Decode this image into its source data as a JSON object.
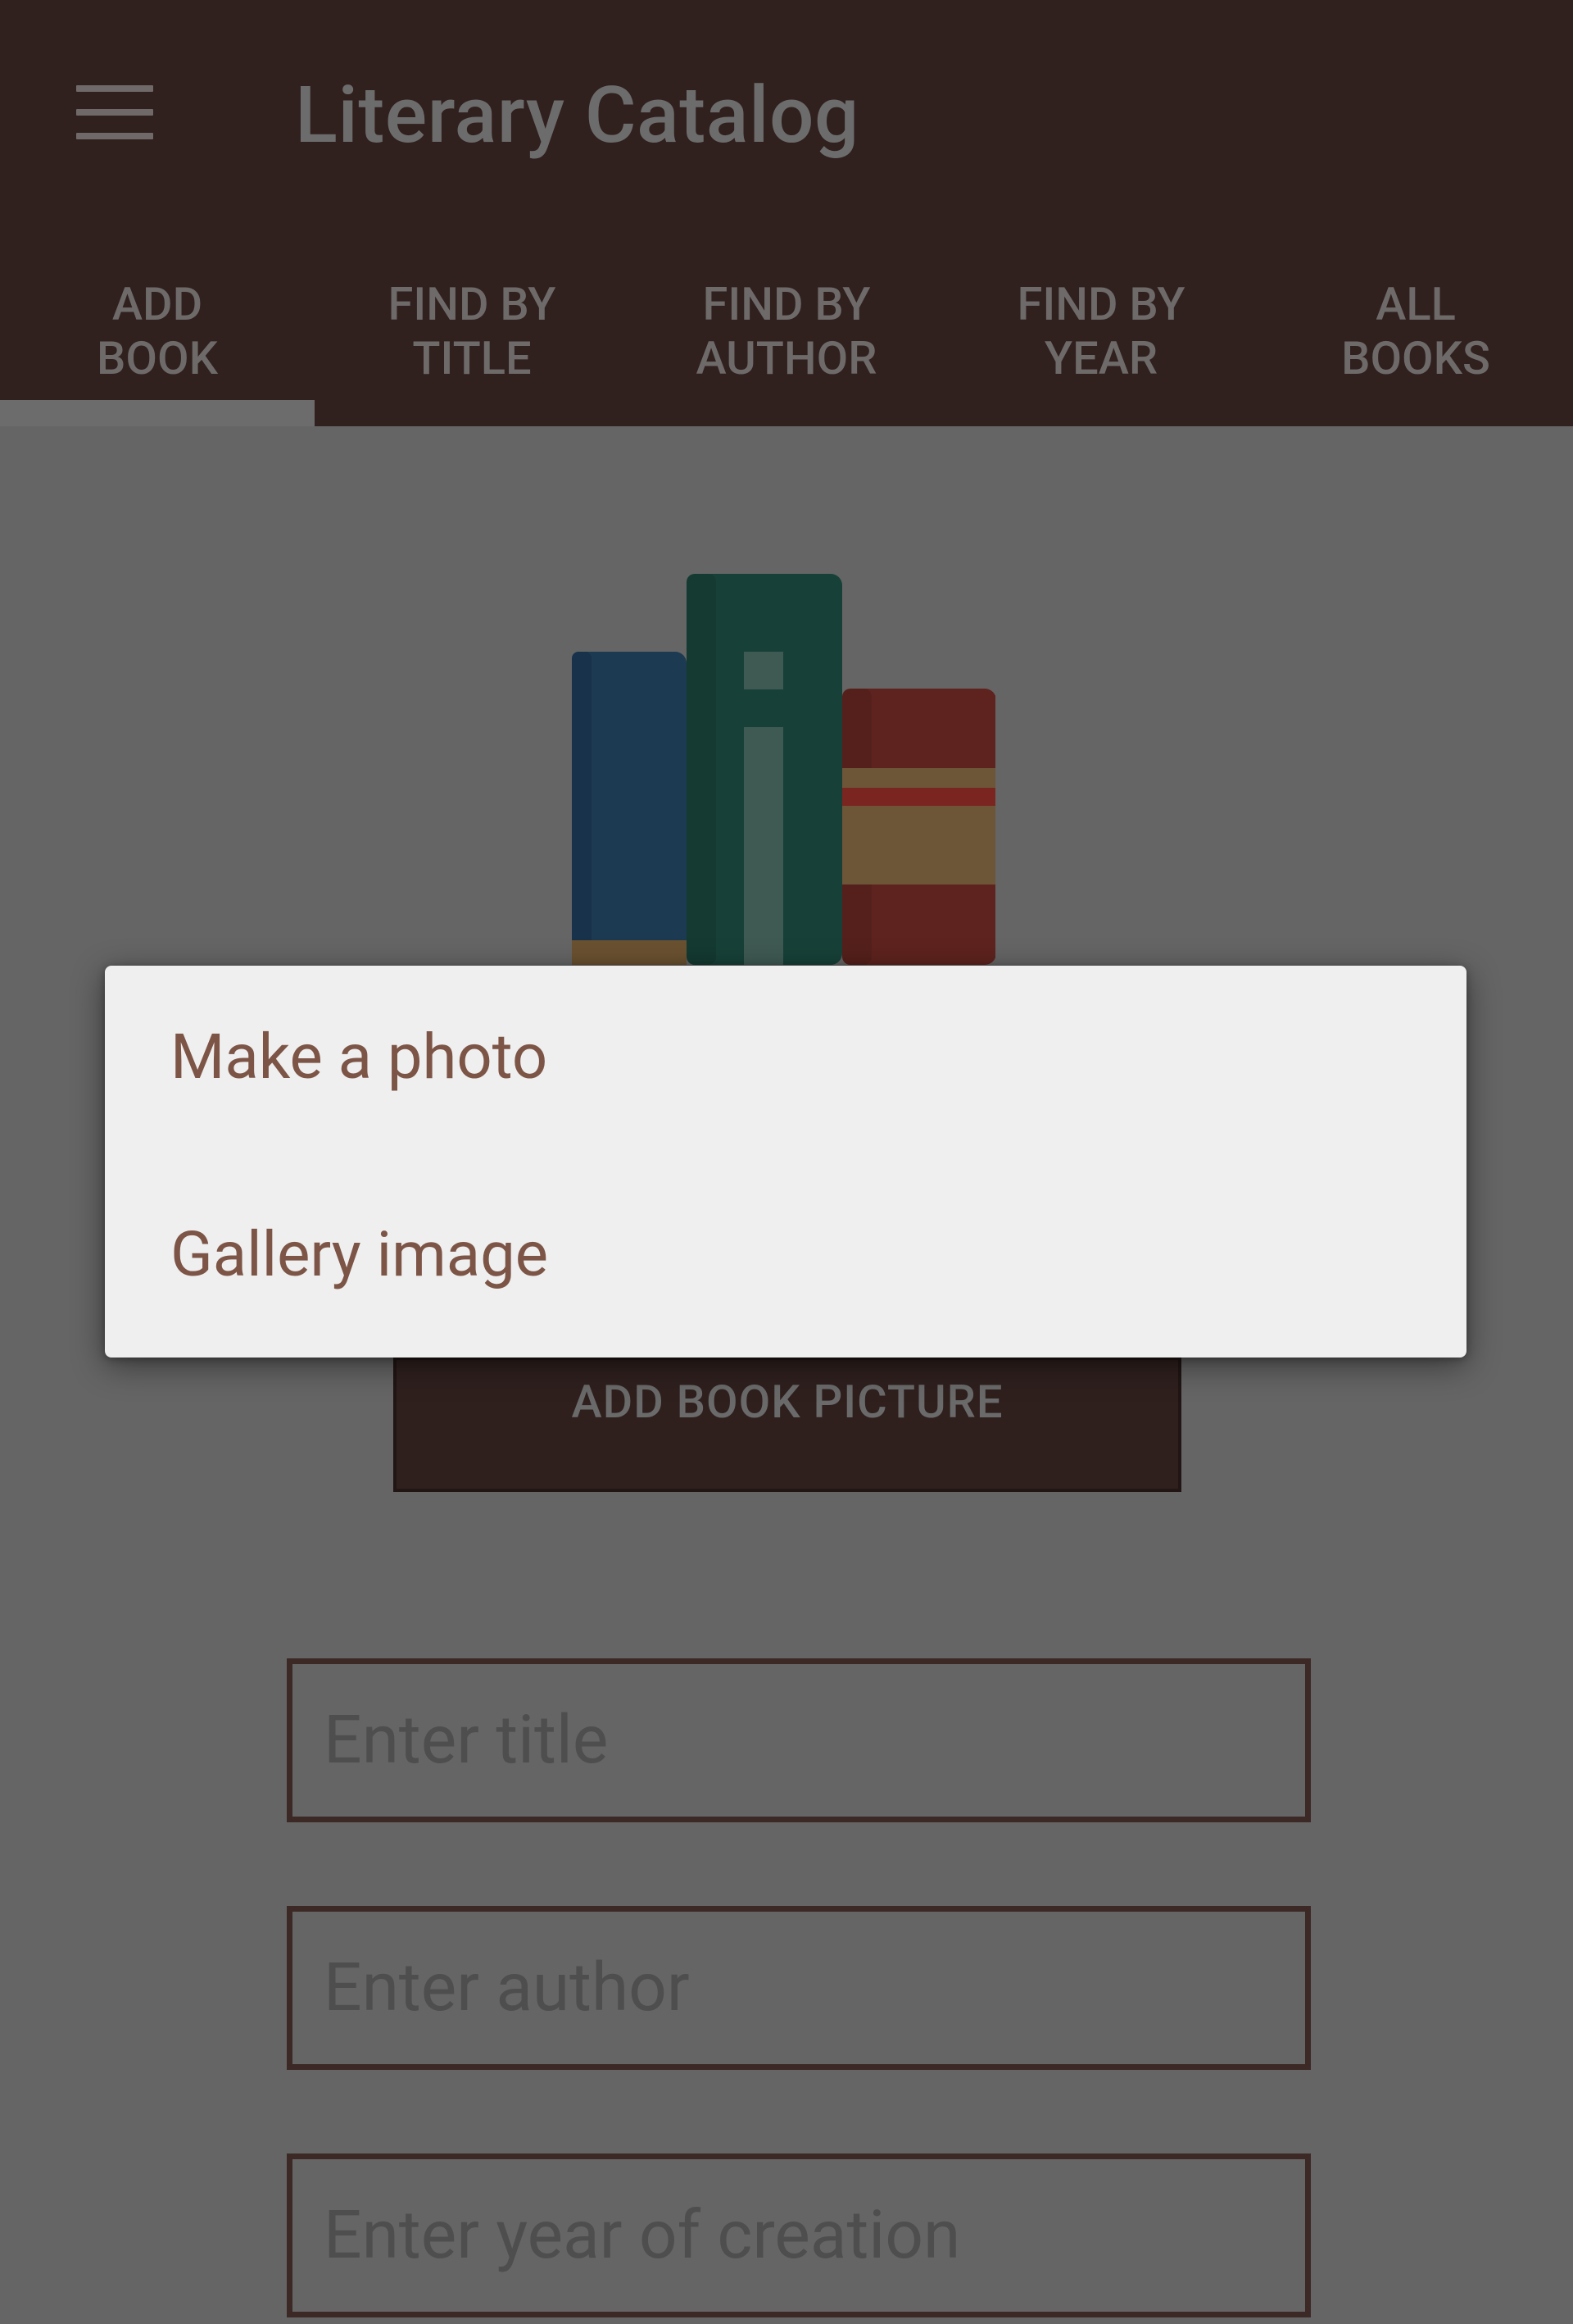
{
  "app": {
    "title": "Literary Catalog"
  },
  "icons": {
    "menu": "hamburger-menu-icon",
    "illustration": "books-illustration"
  },
  "tabs": [
    {
      "label": "ADD\nBOOK",
      "selected": true
    },
    {
      "label": "FIND BY\nTITLE",
      "selected": false
    },
    {
      "label": "FIND BY\nAUTHOR",
      "selected": false
    },
    {
      "label": "FIND BY\nYEAR",
      "selected": false
    },
    {
      "label": "ALL\nBOOKS",
      "selected": false
    }
  ],
  "form": {
    "add_picture_label": "ADD BOOK PICTURE",
    "title_placeholder": "Enter title",
    "author_placeholder": "Enter author",
    "year_placeholder": "Enter year of creation"
  },
  "picture_dialog": {
    "options": [
      "Make a photo",
      "Gallery image"
    ]
  },
  "colors": {
    "appbar": "#30201e",
    "scrim_background": "#656565",
    "dialog_background": "#efefef",
    "dialog_text": "#7d5547"
  }
}
